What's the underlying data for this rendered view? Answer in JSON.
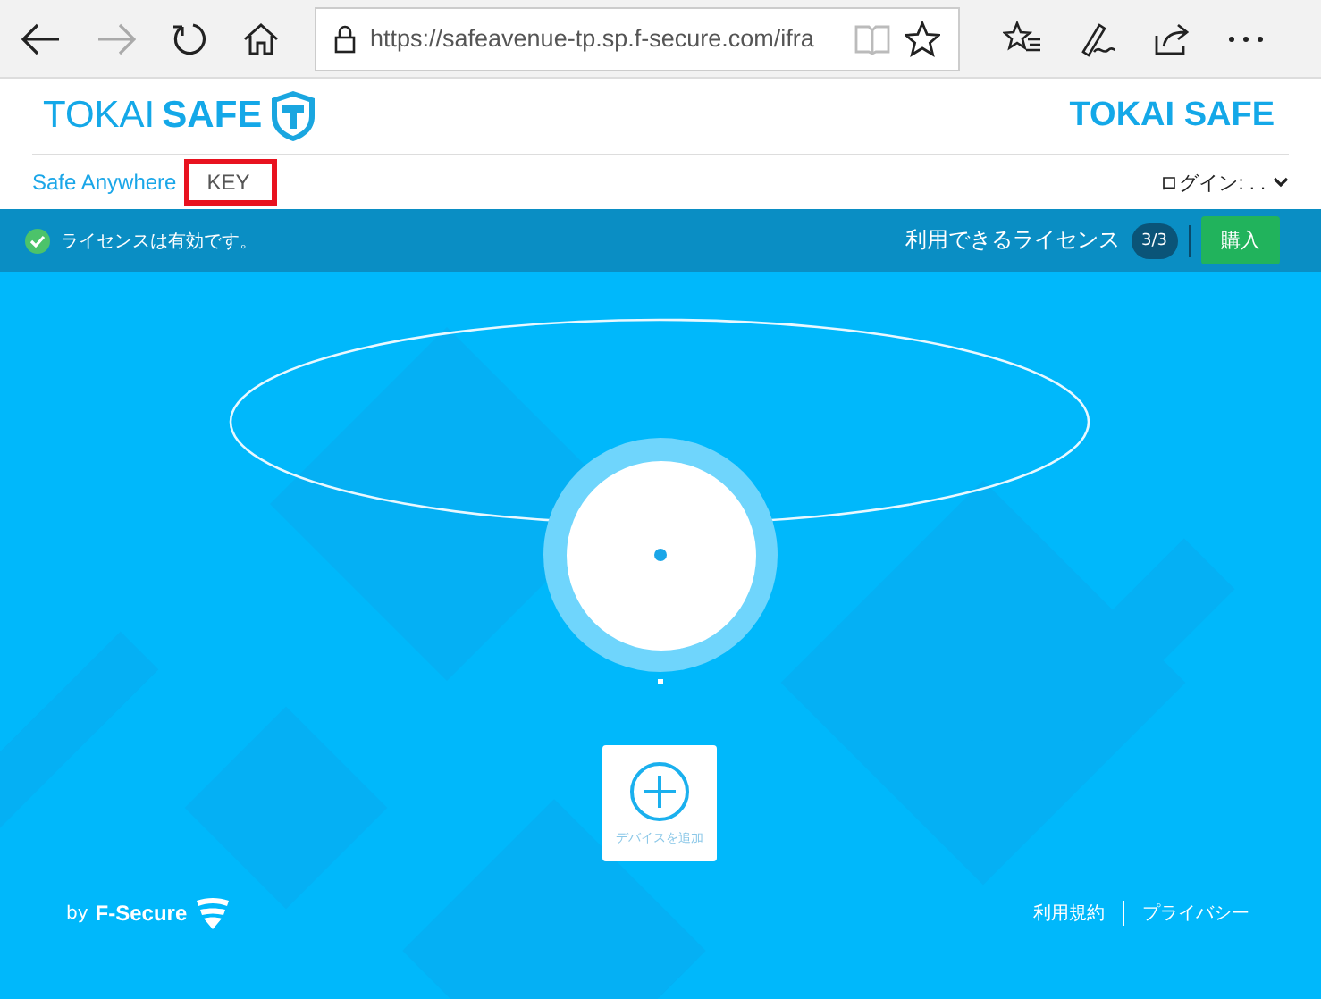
{
  "browser": {
    "url": "https://safeavenue-tp.sp.f-secure.com/ifra"
  },
  "header": {
    "logo_light": "TOKAI",
    "logo_bold": "SAFE",
    "brand_title": "TOKAI SAFE",
    "nav": [
      {
        "label": "Safe Anywhere",
        "selected": false
      },
      {
        "label": "KEY",
        "selected": true,
        "highlighted": true
      }
    ],
    "login": "ログイン: . ."
  },
  "banner": {
    "status": "ライセンスは有効です。",
    "licenses_label": "利用できるライセンス",
    "license_count": "3/3",
    "buy_button": "購入"
  },
  "devices": {
    "add_label": "デバイスを追加"
  },
  "footer": {
    "by": "by",
    "brand": "F-Secure",
    "links": [
      "利用規約",
      "プライバシー"
    ]
  }
}
